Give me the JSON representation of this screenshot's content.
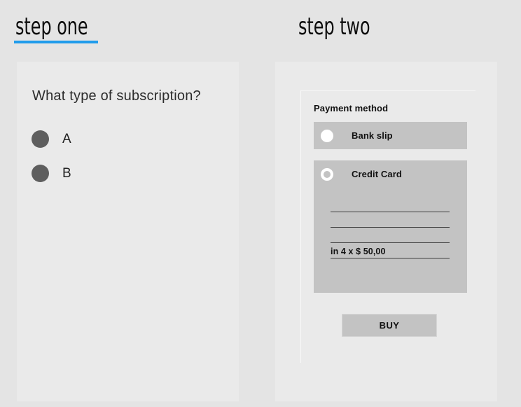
{
  "page": {
    "background_color": "#e4e4e4",
    "panel_color": "#eaeaea",
    "accent_color": "#209ceb",
    "control_gray": "#c3c3c3",
    "radio_gray": "#5e5e5e"
  },
  "steps": [
    {
      "title": "step one",
      "underlined": true,
      "question": "What type of subscription?",
      "options": [
        {
          "label": "A",
          "icon": "radio-filled-gray"
        },
        {
          "label": "B",
          "icon": "radio-filled-gray"
        }
      ]
    },
    {
      "title": "step two",
      "underlined": false,
      "card": {
        "section_label": "Payment method",
        "methods": [
          {
            "label": "Bank slip",
            "icon": "radio-button-selected-white",
            "selected": false
          },
          {
            "label": "Credit Card",
            "icon": "radio-button-ring-white",
            "selected": true,
            "fields": [
              {
                "value": "",
                "placeholder": ""
              },
              {
                "value": "",
                "placeholder": ""
              },
              {
                "value": "",
                "placeholder": ""
              },
              {
                "value": "in 4 x $ 50,00",
                "placeholder": ""
              }
            ]
          }
        ],
        "submit_button": "BUY"
      }
    }
  ]
}
